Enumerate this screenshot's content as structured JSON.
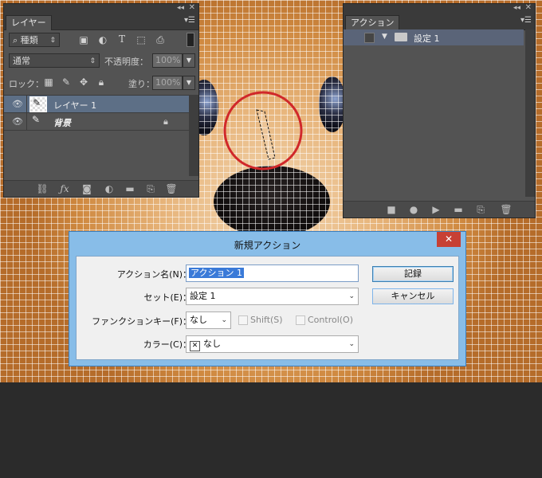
{
  "layers_panel": {
    "tab": "レイヤー",
    "filter_select": "種類",
    "blend_mode": "通常",
    "opacity_label": "不透明度：",
    "opacity_value": "100%",
    "lock_label": "ロック：",
    "fill_label": "塗り：",
    "fill_value": "100%",
    "layers": [
      {
        "name": "レイヤー 1",
        "selected": true
      },
      {
        "name": "背景",
        "selected": false
      }
    ]
  },
  "actions_panel": {
    "tab": "アクション",
    "set_name": "設定 1"
  },
  "dialog": {
    "title": "新規アクション",
    "close_label": "✕",
    "action_name_label": "アクション名(N)：",
    "action_name_value": "アクション 1",
    "set_label": "セット(E)：",
    "set_value": "設定 1",
    "function_key_label": "ファンクションキー(F)：",
    "function_key_value": "なし",
    "shift_label": "Shift(S)",
    "control_label": "Control(O)",
    "color_label": "カラー(C)：",
    "color_value": "なし",
    "record_button": "記録",
    "cancel_button": "キャンセル"
  },
  "colors": {
    "selection_circle": "#d0282a",
    "dialog_frame": "#88bde8",
    "close_button": "#c74034",
    "selected_row": "#5d6f86"
  }
}
